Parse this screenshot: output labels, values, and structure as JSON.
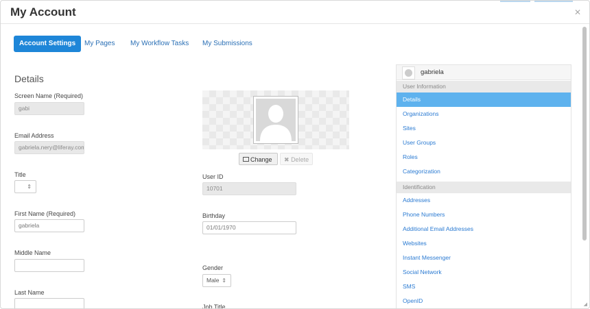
{
  "window": {
    "title": "My Account"
  },
  "tabs": [
    {
      "label": "Account Settings",
      "active": true
    },
    {
      "label": "My Pages",
      "active": false
    },
    {
      "label": "My Workflow Tasks",
      "active": false
    },
    {
      "label": "My Submissions",
      "active": false
    }
  ],
  "details": {
    "title": "Details",
    "screen_name": {
      "label": "Screen Name (Required)",
      "value": "gabi"
    },
    "email": {
      "label": "Email Address",
      "value": "gabriela.nery@liferay.com"
    },
    "title_field": {
      "label": "Title",
      "value": ""
    },
    "first_name": {
      "label": "First Name (Required)",
      "value": "gabriela"
    },
    "middle_name": {
      "label": "Middle Name",
      "value": ""
    },
    "last_name": {
      "label": "Last Name",
      "value": ""
    }
  },
  "portrait": {
    "change_label": "Change",
    "delete_label": "Delete"
  },
  "user_id": {
    "label": "User ID",
    "value": "10701"
  },
  "birthday": {
    "label": "Birthday",
    "value": "01/01/1970"
  },
  "gender": {
    "label": "Gender",
    "value": "Male"
  },
  "job_title": {
    "label": "Job Title"
  },
  "sidebar": {
    "username": "gabriela",
    "user_information": {
      "label": "User Information",
      "items": [
        "Details",
        "Organizations",
        "Sites",
        "User Groups",
        "Roles",
        "Categorization"
      ]
    },
    "identification": {
      "label": "Identification",
      "items": [
        "Addresses",
        "Phone Numbers",
        "Additional Email Addresses",
        "Websites",
        "Instant Messenger",
        "Social Network",
        "SMS",
        "OpenID"
      ]
    }
  },
  "colors": {
    "accent": "#1e86d8",
    "sidebar_active": "#5eb2ee",
    "link": "#2a7ad2"
  }
}
